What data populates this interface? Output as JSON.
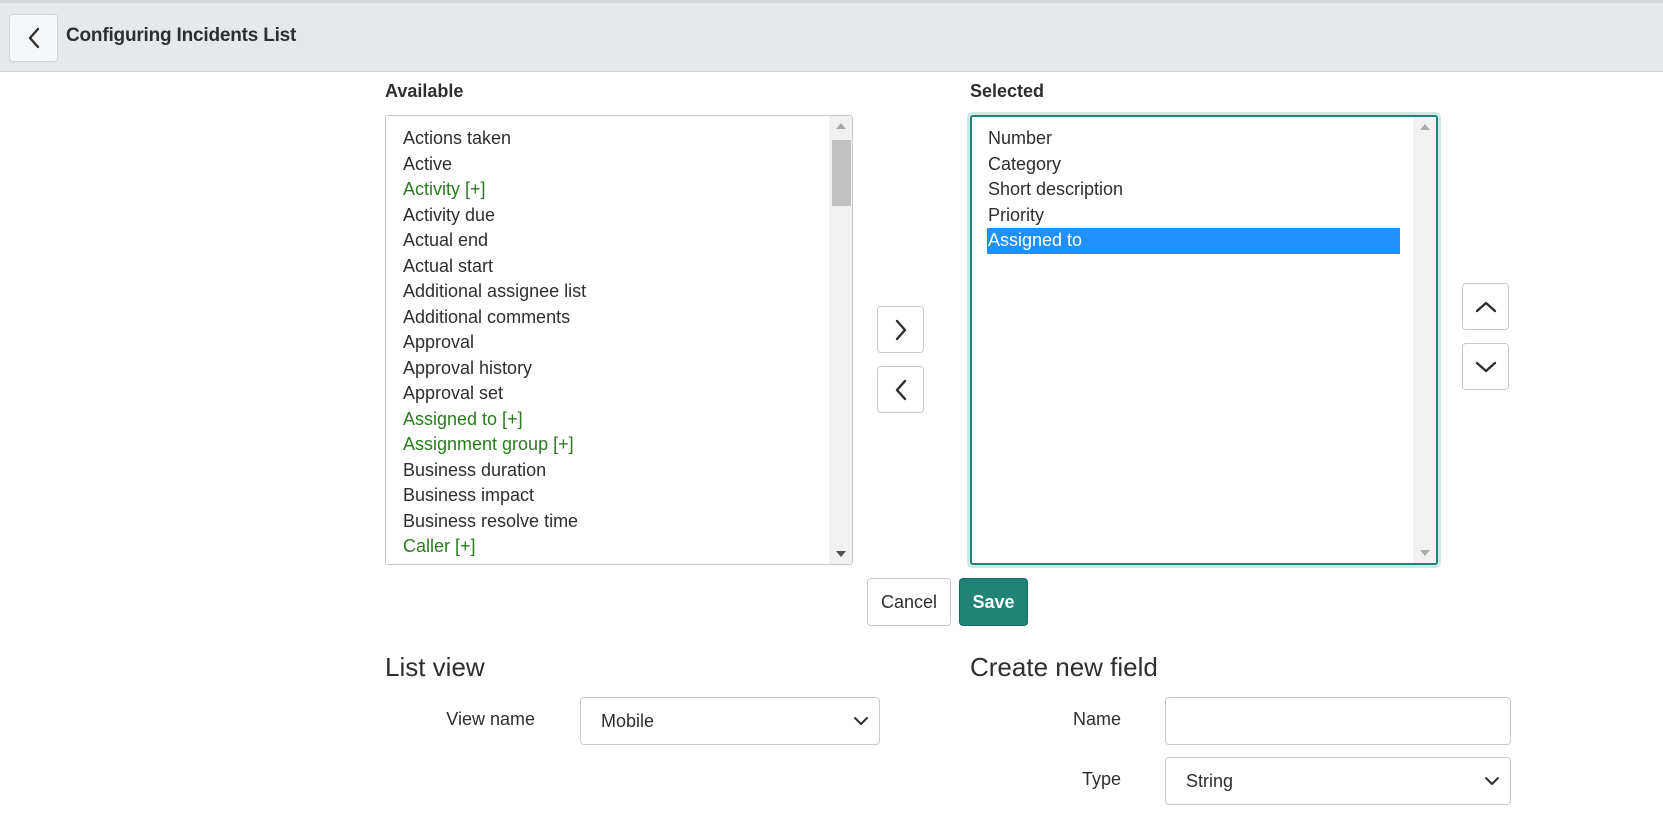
{
  "header": {
    "back_icon": "chevron-left-icon",
    "title": "Configuring Incidents List"
  },
  "available": {
    "label": "Available",
    "items": [
      {
        "label": "Actions taken",
        "kind": "field"
      },
      {
        "label": "Active",
        "kind": "field"
      },
      {
        "label": "Activity [+]",
        "kind": "reference"
      },
      {
        "label": "Activity due",
        "kind": "field"
      },
      {
        "label": "Actual end",
        "kind": "field"
      },
      {
        "label": "Actual start",
        "kind": "field"
      },
      {
        "label": "Additional assignee list",
        "kind": "field"
      },
      {
        "label": "Additional comments",
        "kind": "field"
      },
      {
        "label": "Approval",
        "kind": "field"
      },
      {
        "label": "Approval history",
        "kind": "field"
      },
      {
        "label": "Approval set",
        "kind": "field"
      },
      {
        "label": "Assigned to [+]",
        "kind": "reference"
      },
      {
        "label": "Assignment group [+]",
        "kind": "reference"
      },
      {
        "label": "Business duration",
        "kind": "field"
      },
      {
        "label": "Business impact",
        "kind": "field"
      },
      {
        "label": "Business resolve time",
        "kind": "field"
      },
      {
        "label": "Caller [+]",
        "kind": "reference"
      }
    ]
  },
  "selected": {
    "label": "Selected",
    "items": [
      {
        "label": "Number",
        "selected": false
      },
      {
        "label": "Category",
        "selected": false
      },
      {
        "label": "Short description",
        "selected": false
      },
      {
        "label": "Priority",
        "selected": false
      },
      {
        "label": "Assigned to",
        "selected": true
      }
    ]
  },
  "transfer_buttons": {
    "add_icon": "chevron-right-icon",
    "remove_icon": "chevron-left-icon"
  },
  "order_buttons": {
    "up_icon": "chevron-up-icon",
    "down_icon": "chevron-down-icon"
  },
  "actions": {
    "cancel_label": "Cancel",
    "save_label": "Save"
  },
  "list_view": {
    "title": "List view",
    "view_name_label": "View name",
    "view_name_value": "Mobile"
  },
  "create_field": {
    "title": "Create new field",
    "name_label": "Name",
    "name_value": "",
    "type_label": "Type",
    "type_value": "String"
  },
  "colors": {
    "accent": "#1f8476",
    "reference_text": "#2a7a1f",
    "selection": "#1e90ff",
    "header_bg": "#e6e9ec"
  }
}
